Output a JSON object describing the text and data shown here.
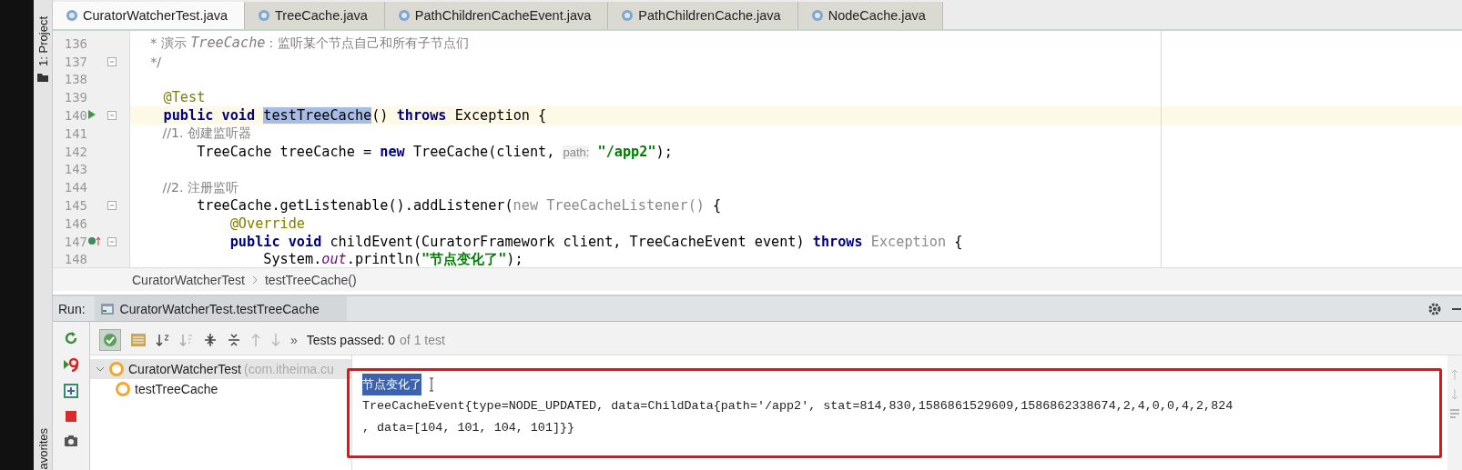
{
  "side_labels": {
    "top": "1: Project",
    "bottom": "avorites"
  },
  "tabs": [
    {
      "label": "CuratorWatcherTest.java",
      "selected": true
    },
    {
      "label": "TreeCache.java",
      "selected": false
    },
    {
      "label": "PathChildrenCacheEvent.java",
      "selected": false
    },
    {
      "label": "PathChildrenCache.java",
      "selected": false
    },
    {
      "label": "NodeCache.java",
      "selected": false
    }
  ],
  "editor": {
    "lines": [
      {
        "number": "136",
        "current": false,
        "fold": false,
        "segments": [
          {
            "kind": "comment",
            "text": "     * 演示 "
          },
          {
            "kind": "comment-code",
            "text": "TreeCache"
          },
          {
            "kind": "comment",
            "text": "：监听某个节点自己和所有子节点们"
          }
        ]
      },
      {
        "number": "137",
        "current": false,
        "fold": true,
        "segments": [
          {
            "kind": "comment",
            "text": "     */"
          }
        ]
      },
      {
        "number": "138",
        "current": false,
        "fold": false
      },
      {
        "number": "139",
        "current": false,
        "fold": false,
        "segments": [
          {
            "kind": "annotation",
            "text": "    @Test"
          }
        ]
      },
      {
        "number": "140",
        "current": true,
        "fold": true,
        "kind": "run",
        "segments": [
          {
            "kind": "keyword",
            "text": "    public void "
          },
          {
            "kind": "selected",
            "text": "testTreeCache"
          },
          {
            "kind": "plain",
            "text": "() "
          },
          {
            "kind": "keyword",
            "text": "throws "
          },
          {
            "kind": "plain",
            "text": "Exception {"
          }
        ]
      },
      {
        "number": "141",
        "current": false,
        "fold": false,
        "segments": [
          {
            "kind": "comment",
            "text": "        //1. 创建监听器"
          }
        ]
      },
      {
        "number": "142",
        "current": false,
        "fold": false,
        "segments": [
          {
            "kind": "plain",
            "text": "        TreeCache treeCache = "
          },
          {
            "kind": "keyword",
            "text": "new "
          },
          {
            "kind": "plain",
            "text": "TreeCache(client, "
          },
          {
            "kind": "hint",
            "text": "path:"
          },
          {
            "kind": "string",
            "text": " \"/app2\""
          },
          {
            "kind": "plain",
            "text": ");"
          }
        ]
      },
      {
        "number": "143",
        "current": false,
        "fold": false
      },
      {
        "number": "144",
        "current": false,
        "fold": false,
        "segments": [
          {
            "kind": "comment",
            "text": "        //2. 注册监听"
          }
        ]
      },
      {
        "number": "145",
        "current": false,
        "fold": true,
        "segments": [
          {
            "kind": "plain",
            "text": "        treeCache.getListenable().addListener("
          },
          {
            "kind": "dim",
            "text": "new TreeCacheListener()"
          },
          {
            "kind": "plain",
            "text": " {"
          }
        ]
      },
      {
        "number": "146",
        "current": false,
        "fold": false,
        "segments": [
          {
            "kind": "annotation",
            "text": "            @Override"
          }
        ]
      },
      {
        "number": "147",
        "current": false,
        "fold": true,
        "kind": "override",
        "segments": [
          {
            "kind": "keyword",
            "text": "            public void "
          },
          {
            "kind": "plain",
            "text": "childEvent(CuratorFramework client, TreeCacheEvent event) "
          },
          {
            "kind": "keyword",
            "text": "throws "
          },
          {
            "kind": "dim",
            "text": "Exception"
          },
          {
            "kind": "plain",
            "text": " {"
          }
        ]
      },
      {
        "number": "148",
        "current": false,
        "fold": false,
        "segments": [
          {
            "kind": "plain",
            "text": "                System."
          },
          {
            "kind": "static",
            "text": "out"
          },
          {
            "kind": "plain",
            "text": ".println("
          },
          {
            "kind": "string",
            "text": "\"节点变化了\""
          },
          {
            "kind": "plain",
            "text": ");"
          }
        ]
      }
    ]
  },
  "breadcrumb": [
    "CuratorWatcherTest",
    "testTreeCache()"
  ],
  "run": {
    "label": "Run:",
    "tab": "CuratorWatcherTest.testTreeCache",
    "overflow": "»",
    "status": "Tests passed: 0",
    "status_detail": "of 1 test",
    "tree": [
      {
        "label": "CuratorWatcherTest",
        "hint": "(com.itheima.cu",
        "expanded": true,
        "children": [
          {
            "label": "testTreeCache"
          }
        ]
      }
    ],
    "console": [
      {
        "text": "节点变化了",
        "selected": true
      },
      {
        "text": "TreeCacheEvent{type=NODE_UPDATED, data=ChildData{path='/app2', stat=814,830,1586861529609,1586862338674,2,4,0,0,4,2,824",
        "selected": false
      },
      {
        "text": ", data=[104, 101, 104, 101]}}",
        "selected": false
      }
    ]
  }
}
